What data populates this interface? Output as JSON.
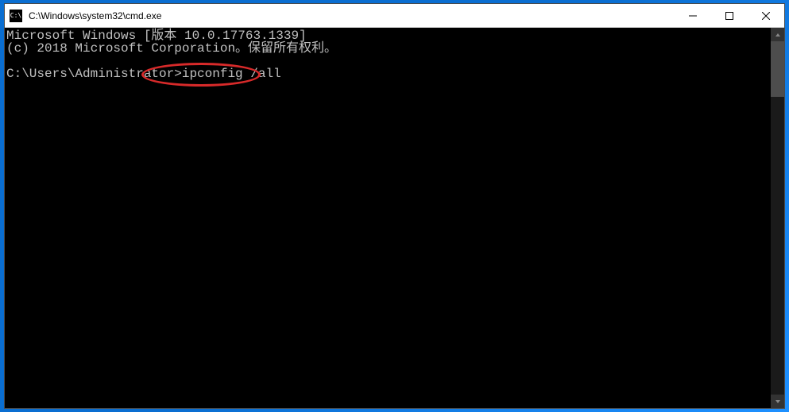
{
  "window": {
    "title": "C:\\Windows\\system32\\cmd.exe",
    "icon_label": "cmd-icon"
  },
  "console": {
    "line1": "Microsoft Windows [版本 10.0.17763.1339]",
    "line2": "(c) 2018 Microsoft Corporation。保留所有权利。",
    "blank": "",
    "prompt": "C:\\Users\\Administrator>",
    "command": "ipconfig /all"
  },
  "annotation": {
    "type": "ellipse-highlight",
    "color": "#d82a2a",
    "target": "command"
  },
  "controls": {
    "minimize": "Minimize",
    "maximize": "Maximize",
    "close": "Close"
  }
}
